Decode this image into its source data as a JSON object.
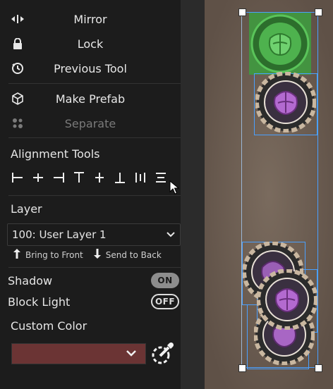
{
  "menu": {
    "mirror": "Mirror",
    "lock": "Lock",
    "previous_tool": "Previous Tool",
    "make_prefab": "Make Prefab",
    "separate": "Separate"
  },
  "alignment": {
    "title": "Alignment Tools"
  },
  "layer": {
    "title": "Layer",
    "selected": "100: User Layer 1",
    "bring_to_front": "Bring to Front",
    "send_to_back": "Send to Back"
  },
  "shadow": {
    "label": "Shadow",
    "state": "ON"
  },
  "block_light": {
    "label": "Block Light",
    "state": "OFF"
  },
  "custom_color": {
    "label": "Custom Color",
    "swatch": "#6b3434"
  },
  "colors": {
    "selection": "#4aa0ff",
    "board": "#6a5b4e"
  }
}
